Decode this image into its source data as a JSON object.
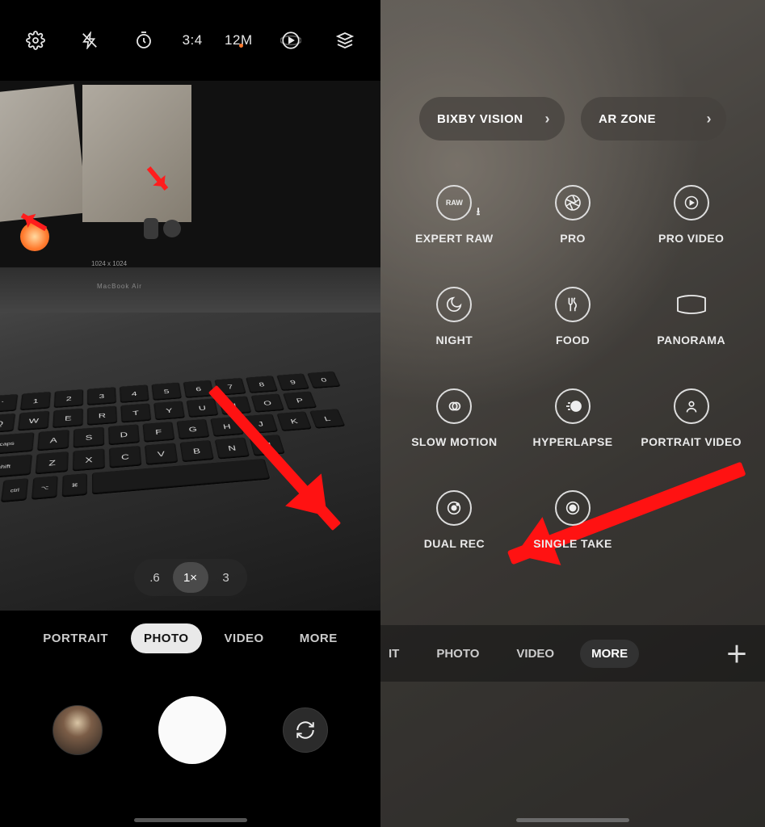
{
  "left": {
    "topbar": {
      "settings_icon": "settings",
      "flash_icon": "flash-off",
      "timer_icon": "timer",
      "ratio": "3:4",
      "resolution": "12M",
      "motion_icon": "motion-photo",
      "filters_icon": "filters"
    },
    "viewfinder": {
      "laptop_model": "MacBook Air",
      "screen_dim": "1024 x 1024"
    },
    "zoom": {
      "opt0": ".6",
      "opt1": "1×",
      "opt2": "3",
      "active": 1
    },
    "modes": {
      "m0": "PORTRAIT",
      "m1": "PHOTO",
      "m2": "VIDEO",
      "m3": "MORE",
      "active": 1
    }
  },
  "right": {
    "pills": {
      "bixby": "BIXBY VISION",
      "arzone": "AR ZONE"
    },
    "grid": [
      {
        "label": "EXPERT RAW",
        "icon": "raw"
      },
      {
        "label": "PRO",
        "icon": "aperture"
      },
      {
        "label": "PRO VIDEO",
        "icon": "play-circle"
      },
      {
        "label": "NIGHT",
        "icon": "moon"
      },
      {
        "label": "FOOD",
        "icon": "food"
      },
      {
        "label": "PANORAMA",
        "icon": "panorama"
      },
      {
        "label": "SLOW MOTION",
        "icon": "slowmo"
      },
      {
        "label": "HYPERLAPSE",
        "icon": "hyperlapse"
      },
      {
        "label": "PORTRAIT VIDEO",
        "icon": "portrait-video"
      },
      {
        "label": "DUAL REC",
        "icon": "dual-rec"
      },
      {
        "label": "SINGLE TAKE",
        "icon": "single-take"
      }
    ],
    "modes": {
      "m0": "IT",
      "m1": "PHOTO",
      "m2": "VIDEO",
      "m3": "MORE",
      "active": 3
    }
  },
  "keys": {
    "r1": [
      "`",
      "1",
      "2",
      "3",
      "4",
      "5",
      "6",
      "7",
      "8",
      "9",
      "0"
    ],
    "r2": [
      "Q",
      "W",
      "E",
      "R",
      "T",
      "Y",
      "U",
      "I",
      "O",
      "P"
    ],
    "r3": [
      "A",
      "S",
      "D",
      "F",
      "G",
      "H",
      "J",
      "K",
      "L"
    ],
    "r4": [
      "Z",
      "X",
      "C",
      "V",
      "B",
      "N",
      "M"
    ]
  }
}
